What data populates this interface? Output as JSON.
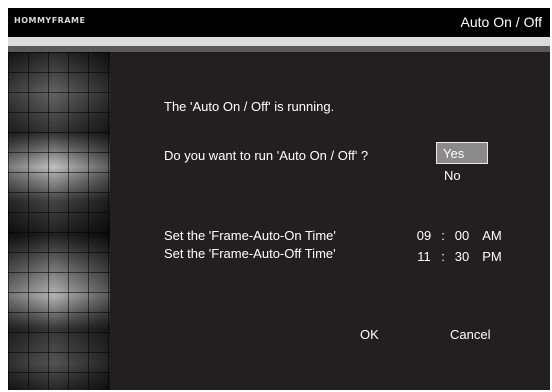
{
  "header": {
    "logo": "HOMMYFRAME",
    "title": "Auto On / Off"
  },
  "dialog": {
    "status": "The 'Auto On / Off' is running.",
    "question": "Do you want to run 'Auto On / Off' ?",
    "options": [
      {
        "label": "Yes",
        "selected": true
      },
      {
        "label": "No",
        "selected": false
      }
    ],
    "on_time": {
      "label": "Set the 'Frame-Auto-On Time'",
      "hour": "09",
      "sep": ":",
      "minute": "00",
      "ampm": "AM"
    },
    "off_time": {
      "label": "Set the 'Frame-Auto-Off Time'",
      "hour": "11",
      "sep": ":",
      "minute": "30",
      "ampm": "PM"
    },
    "ok_label": "OK",
    "cancel_label": "Cancel"
  },
  "colors": {
    "background": "#231f20",
    "highlight": "#8a8a8a",
    "text": "#ffffff"
  }
}
